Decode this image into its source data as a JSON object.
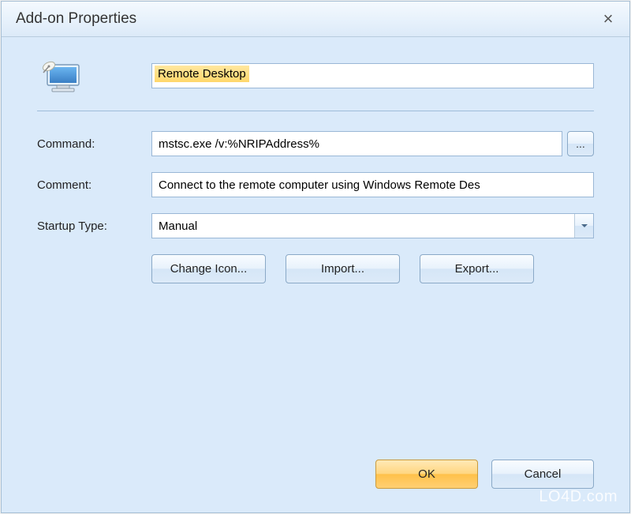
{
  "dialog": {
    "title": "Add-on Properties",
    "close_symbol": "×"
  },
  "fields": {
    "name_value": "Remote Desktop",
    "command_label": "Command:",
    "command_value": "mstsc.exe /v:%NRIPAddress%",
    "browse_label": "...",
    "comment_label": "Comment:",
    "comment_value": "Connect to the remote computer using Windows Remote Des",
    "startup_label": "Startup Type:",
    "startup_value": "Manual"
  },
  "buttons": {
    "change_icon": "Change Icon...",
    "import": "Import...",
    "export": "Export...",
    "ok": "OK",
    "cancel": "Cancel"
  },
  "watermark": "LO4D.com"
}
